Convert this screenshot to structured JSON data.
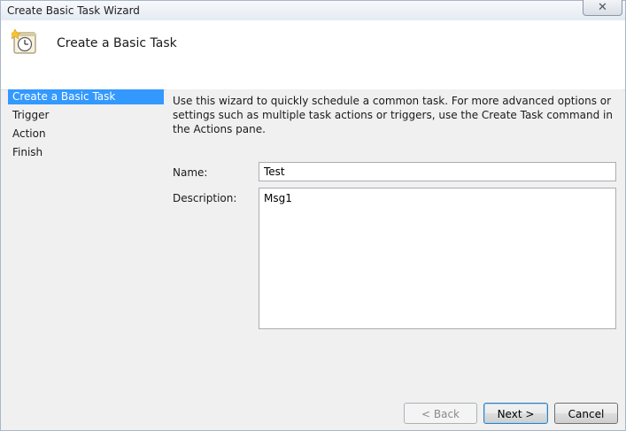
{
  "window": {
    "title": "Create Basic Task Wizard"
  },
  "header": {
    "title": "Create a Basic Task",
    "icon": "task-scheduler-icon"
  },
  "nav": {
    "items": [
      {
        "label": "Create a Basic Task",
        "active": true
      },
      {
        "label": "Trigger"
      },
      {
        "label": "Action"
      },
      {
        "label": "Finish"
      }
    ]
  },
  "main": {
    "intro": "Use this wizard to quickly schedule a common task.  For more advanced options or settings such as multiple task actions or triggers, use the Create Task command in the Actions pane.",
    "name_label": "Name:",
    "name_value": "Test",
    "description_label": "Description:",
    "description_value": "Msg1"
  },
  "footer": {
    "back_label": "< Back",
    "next_label": "Next >",
    "cancel_label": "Cancel"
  },
  "colors": {
    "selection": "#3399ff",
    "accent_border": "#3c7fb1"
  }
}
